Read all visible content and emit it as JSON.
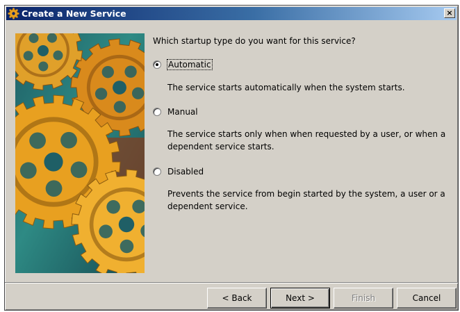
{
  "window": {
    "title": "Create a New Service",
    "close_label": "×"
  },
  "wizard": {
    "question": "Which startup type do you want for this service?",
    "options": [
      {
        "label": "Automatic",
        "checked": true,
        "description": "The service starts automatically when the system starts."
      },
      {
        "label": "Manual",
        "checked": false,
        "description": "The service starts only when when requested by a user, or when a dependent service starts."
      },
      {
        "label": "Disabled",
        "checked": false,
        "description": "Prevents the service from begin started by the system, a user or a dependent service."
      }
    ]
  },
  "buttons": {
    "back": "< Back",
    "next": "Next >",
    "finish": "Finish",
    "cancel": "Cancel"
  },
  "icons": {
    "app": "gear-app-icon",
    "close": "close-icon",
    "banner": "gears-illustration"
  },
  "colors": {
    "titlebar_start": "#0a246a",
    "titlebar_end": "#a6caf0",
    "dialog_face": "#d4d0c8",
    "gear_gold": "#e8a020",
    "gear_teal": "#2a7470"
  }
}
